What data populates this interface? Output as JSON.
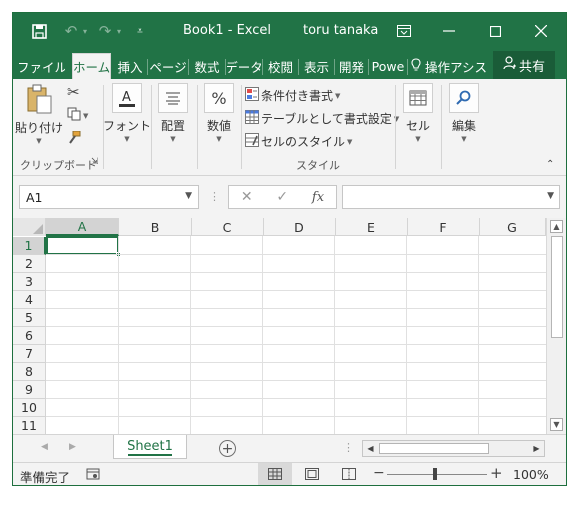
{
  "titlebar": {
    "title": "Book1 - Excel",
    "user": "toru tanaka",
    "icons": [
      "save-icon",
      "undo-icon",
      "redo-icon",
      "customize-icon",
      "ribbon-display-icon",
      "minimize-icon",
      "maximize-icon",
      "close-icon"
    ]
  },
  "ribbon": {
    "tabs": [
      "ファイル",
      "ホーム",
      "挿入",
      "ページ",
      "数式",
      "データ",
      "校閲",
      "表示",
      "開発",
      "Powe"
    ],
    "active_tab": "ホーム",
    "tell_me": "操作アシス",
    "share": "共有",
    "clipboard": {
      "paste": "貼り付け",
      "group_label": "クリップボード"
    },
    "font": "フォント",
    "alignment": "配置",
    "number": "数値",
    "number_icon": "%",
    "styles": {
      "conditional": "条件付き書式",
      "format_table": "テーブルとして書式設定",
      "cell_styles": "セルのスタイル",
      "group_label": "スタイル"
    },
    "cells": "セル",
    "editing": "編集"
  },
  "formula_bar": {
    "name_box": "A1",
    "formula": "",
    "cancel": "✕",
    "enter": "✓",
    "fx": "fx"
  },
  "grid": {
    "columns": [
      "A",
      "B",
      "C",
      "D",
      "E",
      "F",
      "G"
    ],
    "rows": [
      "1",
      "2",
      "3",
      "4",
      "5",
      "6",
      "7",
      "8",
      "9",
      "10",
      "11"
    ],
    "active_cell": "A1"
  },
  "sheets": {
    "tabs": [
      "Sheet1"
    ],
    "active": "Sheet1"
  },
  "status_bar": {
    "status": "準備完了",
    "zoom": "100%"
  },
  "colors": {
    "accent": "#217346",
    "accent_dark": "#1a5c38"
  }
}
